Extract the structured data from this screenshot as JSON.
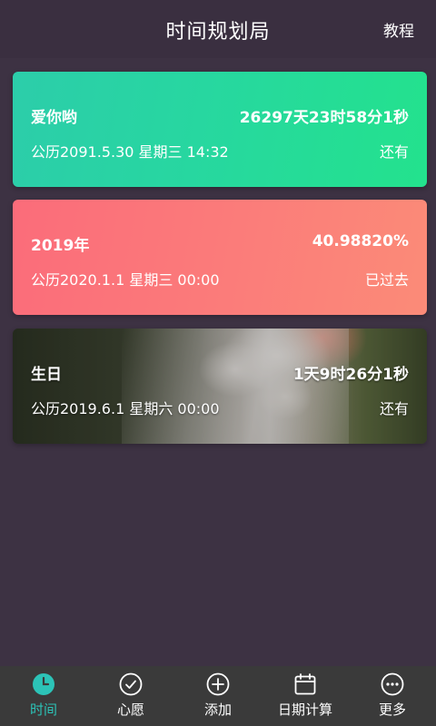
{
  "header": {
    "title": "时间规划局",
    "tutorial_label": "教程"
  },
  "cards": [
    {
      "name": "爱你哟",
      "value": "26297天23时58分1秒",
      "date": "公历2091.5.30  星期三 14:32",
      "status": "还有"
    },
    {
      "name": "2019年",
      "value": "40.98820%",
      "date": "公历2020.1.1 星期三 00:00",
      "status": "已过去"
    },
    {
      "name": "生日",
      "value": "1天9时26分1秒",
      "date": "公历2019.6.1 星期六 00:00",
      "status": "还有"
    }
  ],
  "tabs": [
    {
      "label": "时间",
      "icon": "clock-icon",
      "active": true
    },
    {
      "label": "心愿",
      "icon": "check-circle-icon",
      "active": false
    },
    {
      "label": "添加",
      "icon": "plus-circle-icon",
      "active": false
    },
    {
      "label": "日期计算",
      "icon": "calendar-icon",
      "active": false
    },
    {
      "label": "更多",
      "icon": "more-icon",
      "active": false
    }
  ],
  "colors": {
    "background": "#3d3243",
    "accent": "#2cc3b7",
    "card_green": "#27d7a0",
    "card_red": "#fb7b7a",
    "tabbar": "#3a3a3a"
  }
}
